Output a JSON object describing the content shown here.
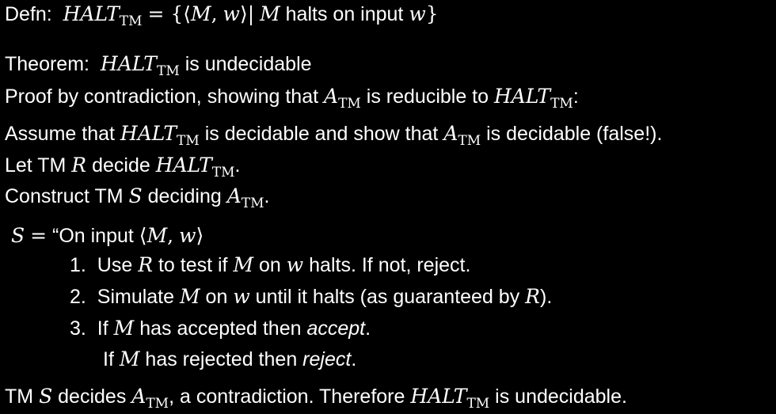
{
  "defn": {
    "label": "Defn:",
    "halt": "HALT",
    "tm": "TM",
    "eq_open": "= {⟨",
    "M": "M",
    "comma": ",",
    "w": "w",
    "close_bar": "⟩|",
    "M2": "M",
    "halts_text": "halts on input",
    "w2": "w",
    "close_brace": "}"
  },
  "theorem": {
    "label": "Theorem:",
    "halt": "HALT",
    "tm": "TM",
    "text": "is undecidable"
  },
  "proof": {
    "text1": "Proof by contradiction, showing that",
    "A": "A",
    "tm": "TM",
    "text2": "is reducible to",
    "halt": "HALT",
    "tm2": "TM",
    "colon": ":"
  },
  "assume": {
    "text1": "Assume that",
    "halt": "HALT",
    "tm": "TM",
    "text2": "is decidable and show that",
    "A": "A",
    "tm2": "TM",
    "text3": "is decidable (false!)."
  },
  "let": {
    "text1": "Let TM",
    "R": "R",
    "text2": "decide",
    "halt": "HALT",
    "tm": "TM",
    "dot": "."
  },
  "construct": {
    "text1": "Construct TM",
    "S": "S",
    "text2": "deciding",
    "A": "A",
    "tm": "TM",
    "dot": "."
  },
  "sdef": {
    "S": "S",
    "eq": "=",
    "text": "“On input",
    "open": "⟨",
    "M": "M",
    "comma": ",",
    "w": "w",
    "close": "⟩"
  },
  "step1": {
    "num": "1.",
    "text1": "Use",
    "R": "R",
    "text2": "to test if",
    "M": "M",
    "text3": "on",
    "w": "w",
    "text4": "halts.  If not, reject."
  },
  "step2": {
    "num": "2.",
    "text1": "Simulate",
    "M": "M",
    "text2": "on",
    "w": "w",
    "text3": "until it halts (as guaranteed by",
    "R": "R",
    "text4": ")."
  },
  "step3": {
    "num": "3.",
    "text1": "If",
    "M": "M",
    "text2": "has accepted then",
    "accept": "accept",
    "dot": "."
  },
  "step3b": {
    "text1": "If",
    "M": "M",
    "text2": "has rejected then",
    "reject": "reject",
    "dot": "."
  },
  "conclusion": {
    "text1": "TM",
    "S": "S",
    "text2": "decides",
    "A": "A",
    "tm": "TM",
    "text3": ", a contradiction.  Therefore",
    "halt": "HALT",
    "tm2": "TM",
    "text4": "is undecidable."
  }
}
